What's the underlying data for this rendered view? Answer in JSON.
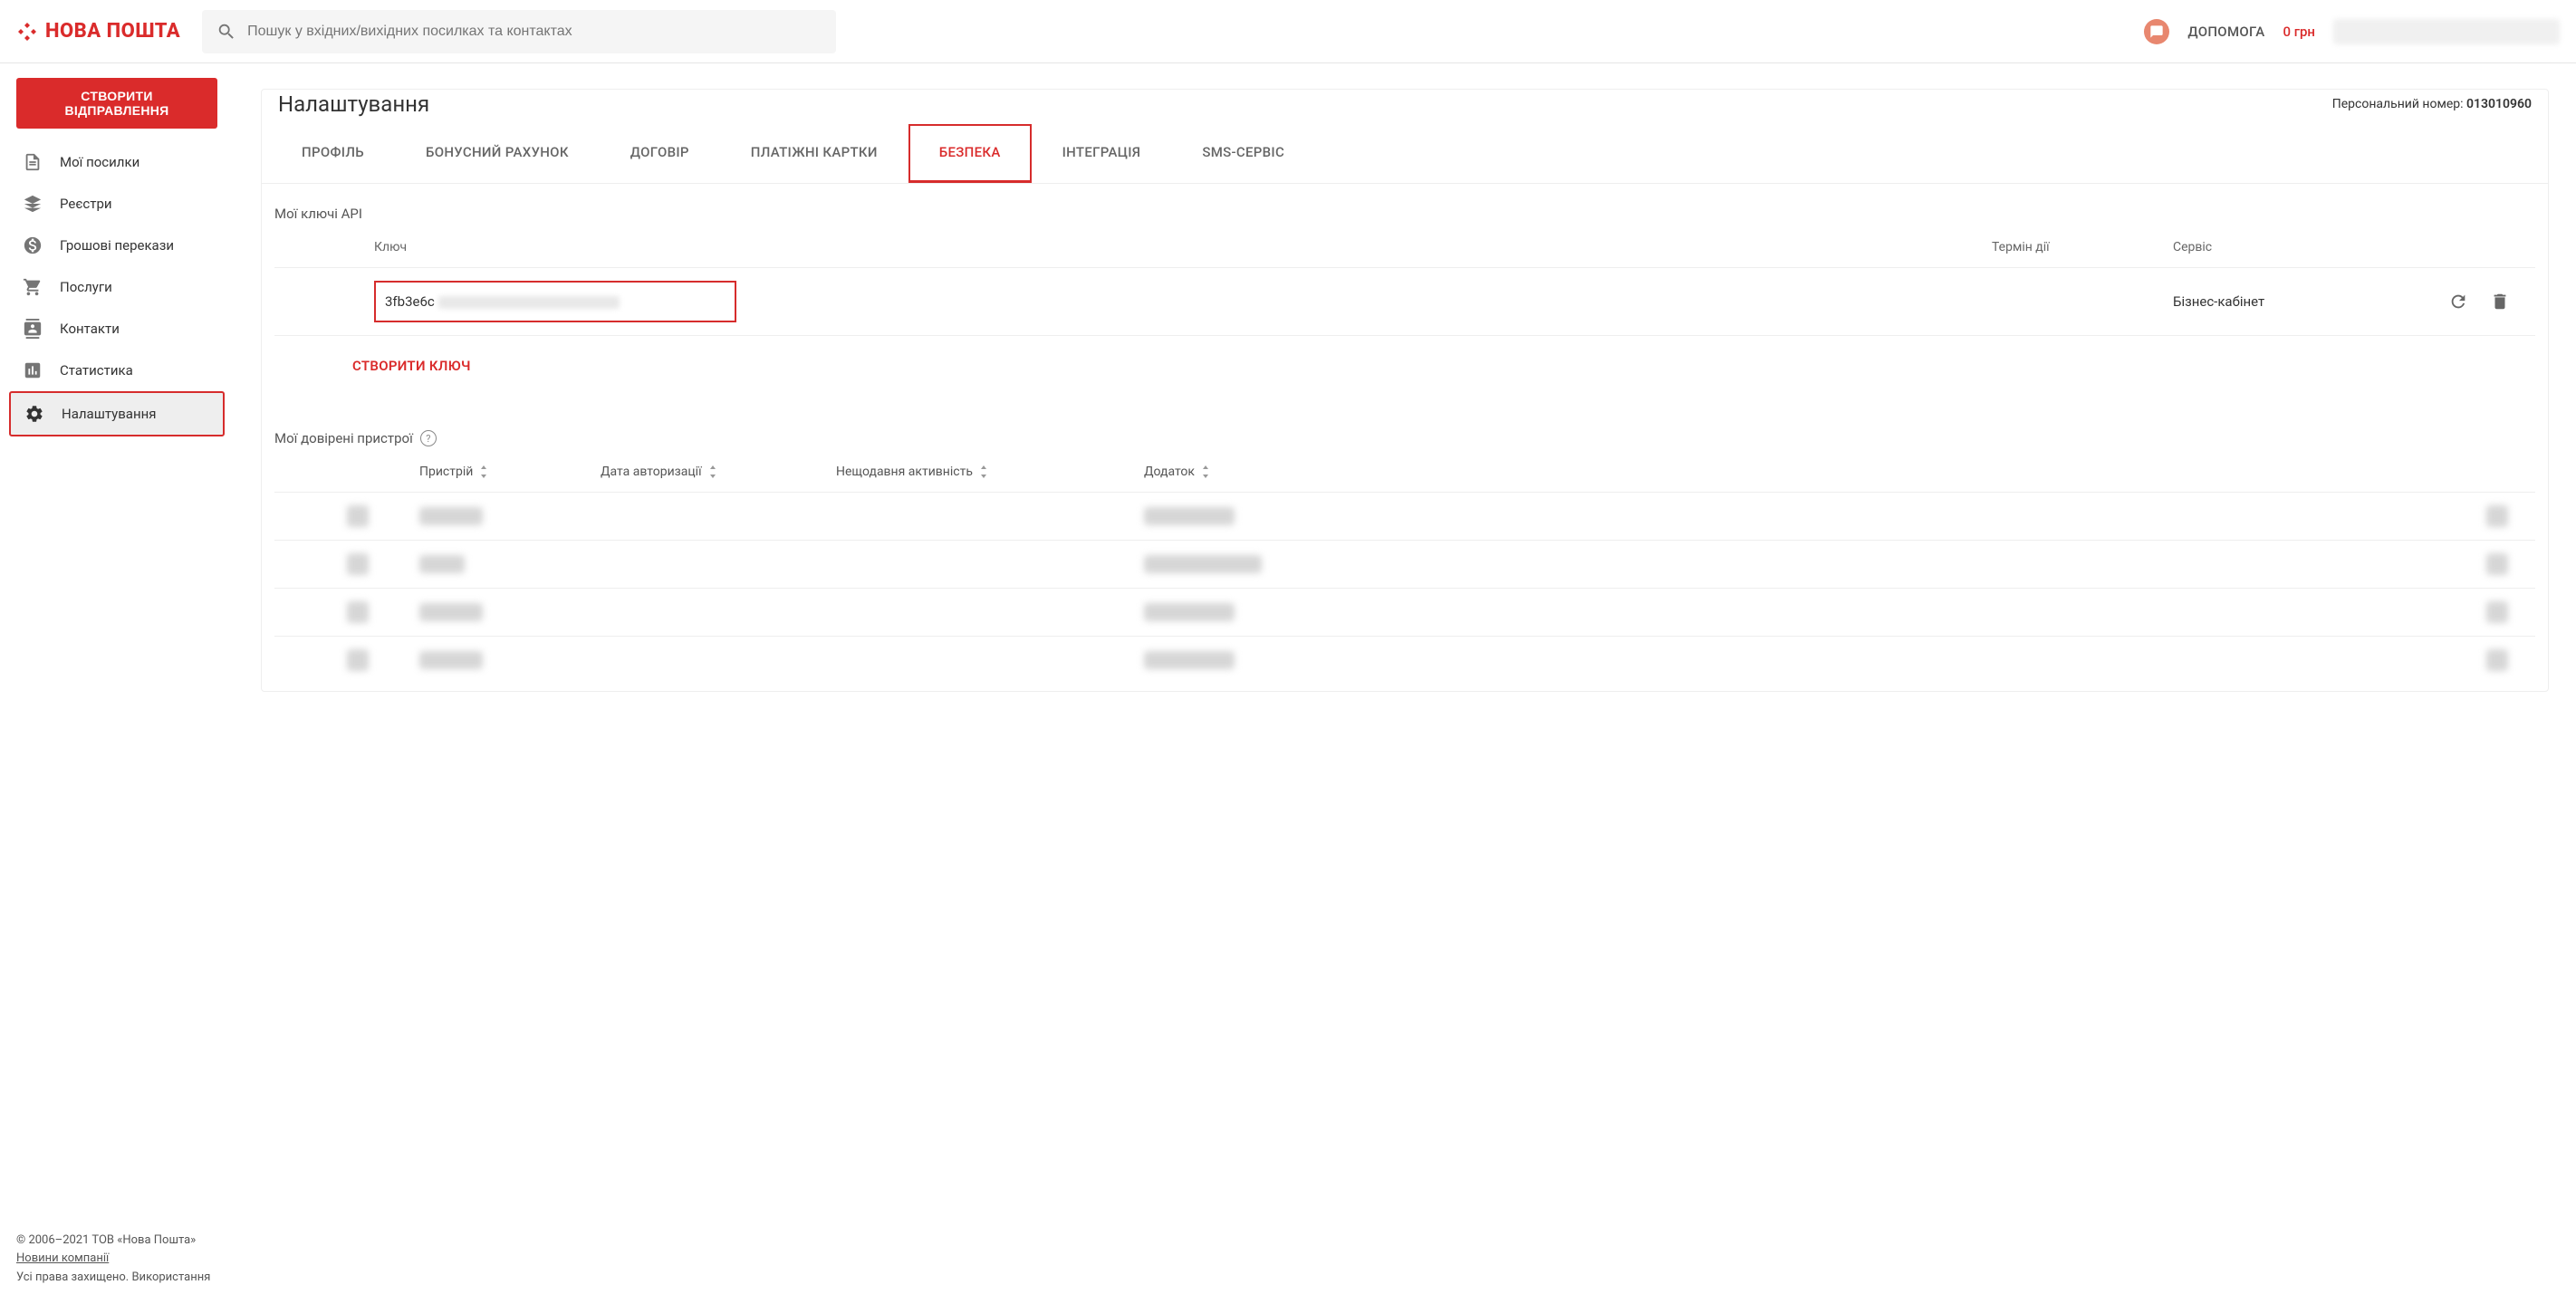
{
  "brand": "НОВА ПОШТА",
  "search": {
    "placeholder": "Пошук у вхідних/вихідних посилках та контактах"
  },
  "header": {
    "help": "ДОПОМОГА",
    "balance": "0 грн"
  },
  "sidebar": {
    "create_btn": "СТВОРИТИ ВІДПРАВЛЕННЯ",
    "items": {
      "shipments": "Мої посилки",
      "registries": "Реєстри",
      "transfers": "Грошові перекази",
      "services": "Послуги",
      "contacts": "Контакти",
      "stats": "Статистика",
      "settings": "Налаштування"
    },
    "footer": {
      "copyright": "© 2006–2021 ТОВ «Нова Пошта»",
      "news_link": "Новини компанії",
      "rights": "Усі права захищено. Використання"
    }
  },
  "main": {
    "title": "Налаштування",
    "personal_label": "Персональний номер: ",
    "personal_value": "013010960"
  },
  "tabs": {
    "profile": "ПРОФІЛЬ",
    "bonus": "БОНУСНИЙ РАХУНОК",
    "contract": "ДОГОВІР",
    "cards": "ПЛАТІЖНІ КАРТКИ",
    "security": "БЕЗПЕКА",
    "integration": "ІНТЕГРАЦІЯ",
    "sms": "SMS-СЕРВІС"
  },
  "api": {
    "section_title": "Мої ключі API",
    "col_key": "Ключ",
    "col_expiry": "Термін дії",
    "col_service": "Сервіс",
    "key_value": "3fb3e6c",
    "service_value": "Бізнес-кабінет",
    "create_key": "СТВОРИТИ КЛЮЧ"
  },
  "devices": {
    "section_title": "Мої довірені пристрої",
    "col_device": "Пристрій",
    "col_auth_date": "Дата авторизації",
    "col_activity": "Нещодавня активність",
    "col_app": "Додаток"
  }
}
